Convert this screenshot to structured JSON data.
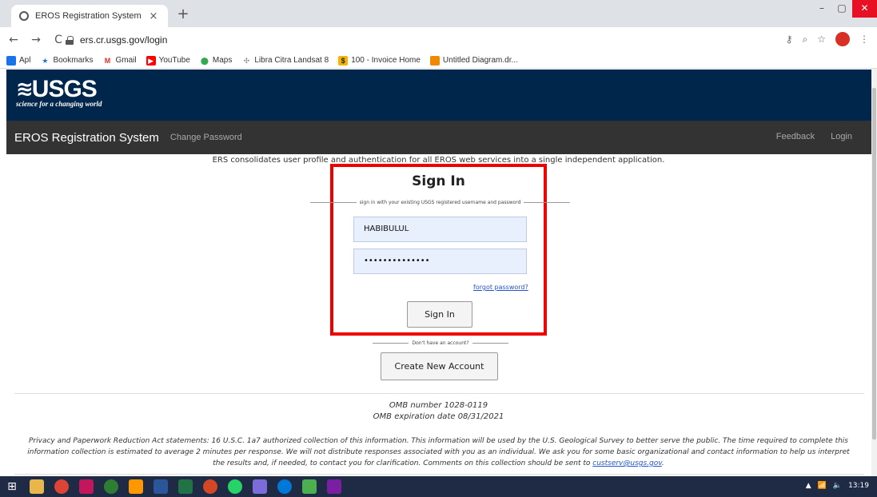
{
  "browser": {
    "tab_title": "EROS Registration System",
    "tab_close": "×",
    "new_tab": "+",
    "url": "ers.cr.usgs.gov/login",
    "window": {
      "minimize": "–",
      "maximize": "▢",
      "close": "✕"
    },
    "nav": {
      "back": "←",
      "forward": "→",
      "reload": "C"
    },
    "bookmarks": [
      {
        "label": "Apl",
        "icon": "apps-grid-icon",
        "color": "#1a73e8"
      },
      {
        "label": "Bookmarks",
        "icon": "star-icon",
        "color": "#1a73e8"
      },
      {
        "label": "Gmail",
        "icon": "gmail-icon",
        "color": "#d93025"
      },
      {
        "label": "YouTube",
        "icon": "youtube-icon",
        "color": "#ff0000"
      },
      {
        "label": "Maps",
        "icon": "maps-pin-icon",
        "color": "#34a853"
      },
      {
        "label": "Libra Citra Landsat 8",
        "icon": "satellite-icon",
        "color": "#888888"
      },
      {
        "label": "100 - Invoice Home",
        "icon": "dollar-icon",
        "color": "#f4b400"
      },
      {
        "label": "Untitled Diagram.dr...",
        "icon": "drawio-icon",
        "color": "#f08705"
      }
    ]
  },
  "site": {
    "logo_text": "USGS",
    "tagline": "science for a changing world",
    "app_title": "EROS Registration System",
    "nav_links": {
      "change_password": "Change Password",
      "feedback": "Feedback",
      "login": "Login"
    },
    "brand_color": "#00264c"
  },
  "main": {
    "intro": "ERS consolidates user profile and authentication for all EROS web services into a single independent application.",
    "signin_title": "Sign In",
    "signin_subtitle": "sign in with your existing USGS registered username and password",
    "username_value": "HABIBULUL",
    "password_value": "••••••••••••••",
    "forgot_password": "forgot password?",
    "signin_button": "Sign In",
    "no_account": "Don't have an account?",
    "create_account_button": "Create New Account",
    "highlight_color": "#ee0000"
  },
  "footer": {
    "omb_number": "OMB number 1028-0119",
    "omb_expiration": "OMB expiration date 08/31/2021",
    "privacy": "Privacy and Paperwork Reduction Act statements: 16 U.S.C. 1a7 authorized collection of this information. This information will be used by the U.S. Geological Survey to better serve the public. The time required to complete this information collection is estimated to average 2 minutes per response. We will not distribute responses associated with you as an individual. We ask you for some basic organizational and contact information to help us interpret the results and, if needed, to contact you for clarification. Comments on this collection should be sent to ",
    "email": "custserv@usgs.gov",
    "period": "."
  },
  "taskbar": {
    "clock": "13:19"
  }
}
